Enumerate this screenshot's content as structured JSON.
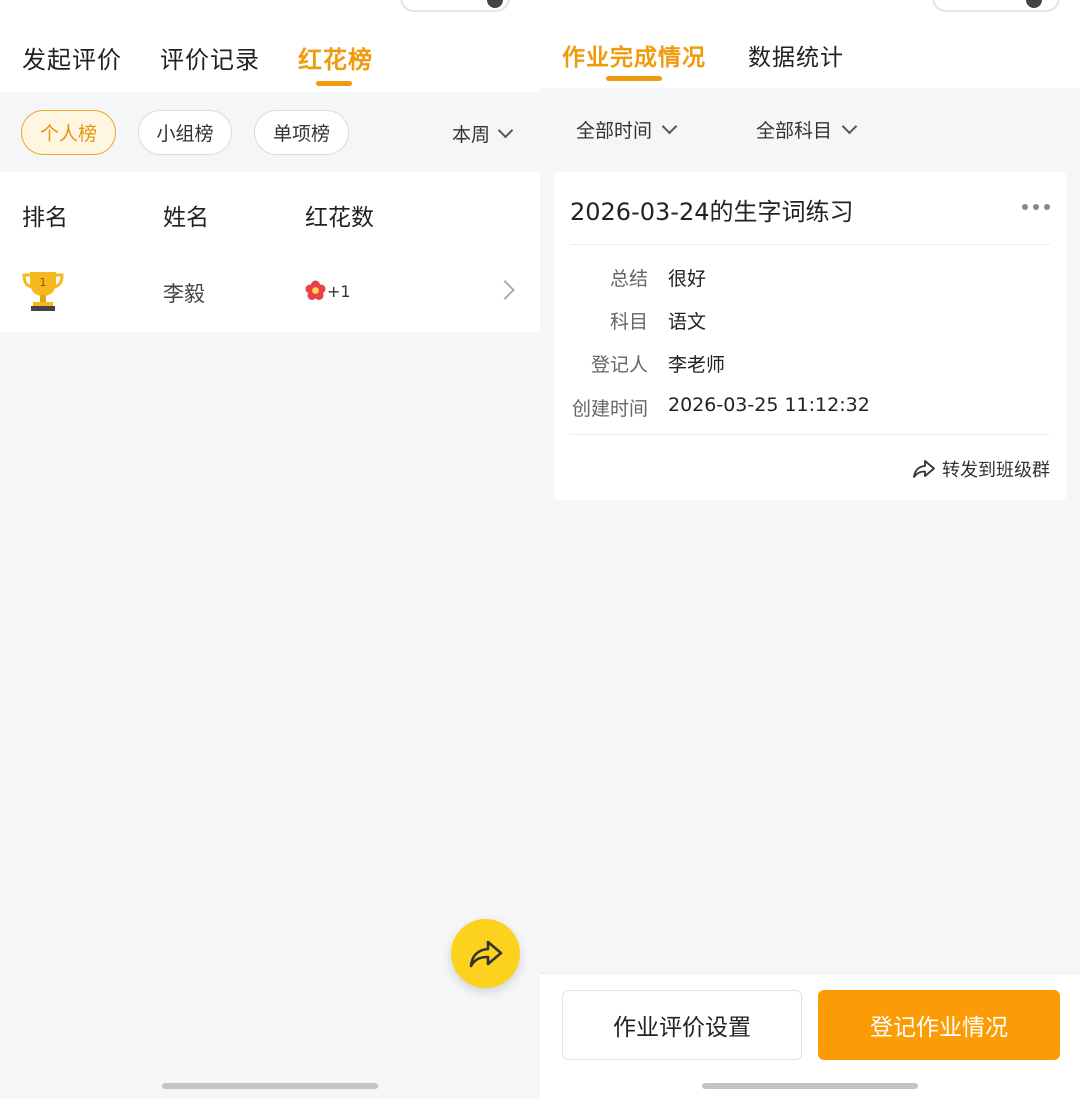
{
  "left": {
    "tabs": [
      {
        "label": "发起评价"
      },
      {
        "label": "评价记录"
      },
      {
        "label": "红花榜"
      }
    ],
    "active_tab": 2,
    "filters": [
      "个人榜",
      "小组榜",
      "单项榜"
    ],
    "active_filter": 0,
    "period": "本周",
    "table": {
      "headers": [
        "排名",
        "姓名",
        "红花数"
      ],
      "rows": [
        {
          "rank": "1",
          "name": "李毅",
          "flowers": "+1"
        }
      ]
    },
    "icons": {
      "share_fab": "share-arrow-icon",
      "rank": "trophy-icon",
      "flower": "red-flower-icon"
    },
    "colors": {
      "accent": "#f09a0e",
      "fab": "#fcd21c"
    }
  },
  "right": {
    "tabs": [
      {
        "label": "作业完成情况"
      },
      {
        "label": "数据统计"
      }
    ],
    "active_tab": 0,
    "dropdowns": [
      "全部时间",
      "全部科目"
    ],
    "card": {
      "title": "2026-03-24的生字词练习",
      "fields": [
        {
          "label": "总结",
          "value": "很好"
        },
        {
          "label": "科目",
          "value": "语文"
        },
        {
          "label": "登记人",
          "value": "李老师"
        },
        {
          "label": "创建时间",
          "value": "2026-03-25 11:12:32"
        }
      ],
      "forward_label": "转发到班级群"
    },
    "buttons": {
      "settings": "作业评价设置",
      "register": "登记作业情况"
    },
    "colors": {
      "primary_button": "#fb9b06"
    }
  }
}
